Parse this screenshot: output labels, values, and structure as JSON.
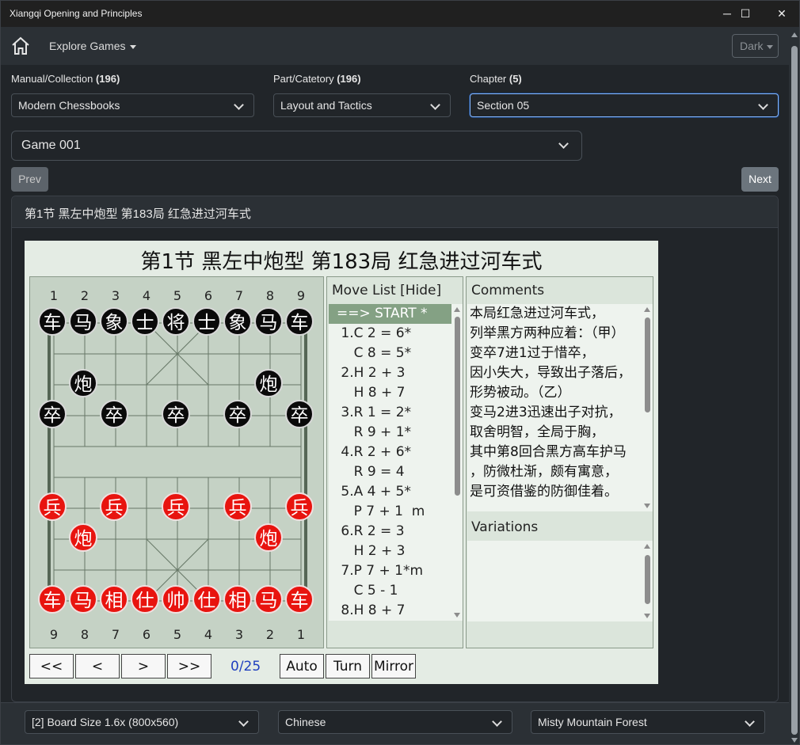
{
  "window": {
    "title": "Xiangqi Opening and Principles",
    "minimize": "─",
    "maximize": "☐",
    "close": "✕"
  },
  "nav": {
    "home_icon": "home-icon",
    "explore": "Explore Games",
    "theme": "Dark"
  },
  "filters": {
    "manual": {
      "label": "Manual/Collection",
      "count": "(196)",
      "value": "Modern Chessbooks"
    },
    "part": {
      "label": "Part/Catetory",
      "count": "(196)",
      "value": "Layout and Tactics"
    },
    "chapter": {
      "label": "Chapter",
      "count": "(5)",
      "value": "Section 05"
    },
    "game": {
      "value": "Game 001"
    }
  },
  "buttons": {
    "prev": "Prev",
    "next": "Next"
  },
  "card": {
    "header": "第1节 黑左中炮型 第183局 红急进过河车式"
  },
  "board": {
    "title": "第1节 黑左中炮型 第183局 红急进过河车式",
    "top_files": [
      "1",
      "2",
      "3",
      "4",
      "5",
      "6",
      "7",
      "8",
      "9"
    ],
    "bottom_files": [
      "9",
      "8",
      "7",
      "6",
      "5",
      "4",
      "3",
      "2",
      "1"
    ],
    "pieces": [
      {
        "side": "black",
        "ch": "车",
        "col": 0,
        "row": 0
      },
      {
        "side": "black",
        "ch": "马",
        "col": 1,
        "row": 0
      },
      {
        "side": "black",
        "ch": "象",
        "col": 2,
        "row": 0
      },
      {
        "side": "black",
        "ch": "士",
        "col": 3,
        "row": 0
      },
      {
        "side": "black",
        "ch": "将",
        "col": 4,
        "row": 0
      },
      {
        "side": "black",
        "ch": "士",
        "col": 5,
        "row": 0
      },
      {
        "side": "black",
        "ch": "象",
        "col": 6,
        "row": 0
      },
      {
        "side": "black",
        "ch": "马",
        "col": 7,
        "row": 0
      },
      {
        "side": "black",
        "ch": "车",
        "col": 8,
        "row": 0
      },
      {
        "side": "black",
        "ch": "炮",
        "col": 1,
        "row": 2
      },
      {
        "side": "black",
        "ch": "炮",
        "col": 7,
        "row": 2
      },
      {
        "side": "black",
        "ch": "卒",
        "col": 0,
        "row": 3
      },
      {
        "side": "black",
        "ch": "卒",
        "col": 2,
        "row": 3
      },
      {
        "side": "black",
        "ch": "卒",
        "col": 4,
        "row": 3
      },
      {
        "side": "black",
        "ch": "卒",
        "col": 6,
        "row": 3
      },
      {
        "side": "black",
        "ch": "卒",
        "col": 8,
        "row": 3
      },
      {
        "side": "red",
        "ch": "兵",
        "col": 0,
        "row": 6
      },
      {
        "side": "red",
        "ch": "兵",
        "col": 2,
        "row": 6
      },
      {
        "side": "red",
        "ch": "兵",
        "col": 4,
        "row": 6
      },
      {
        "side": "red",
        "ch": "兵",
        "col": 6,
        "row": 6
      },
      {
        "side": "red",
        "ch": "兵",
        "col": 8,
        "row": 6
      },
      {
        "side": "red",
        "ch": "炮",
        "col": 1,
        "row": 7
      },
      {
        "side": "red",
        "ch": "炮",
        "col": 7,
        "row": 7
      },
      {
        "side": "red",
        "ch": "车",
        "col": 0,
        "row": 9
      },
      {
        "side": "red",
        "ch": "马",
        "col": 1,
        "row": 9
      },
      {
        "side": "red",
        "ch": "相",
        "col": 2,
        "row": 9
      },
      {
        "side": "red",
        "ch": "仕",
        "col": 3,
        "row": 9
      },
      {
        "side": "red",
        "ch": "帅",
        "col": 4,
        "row": 9
      },
      {
        "side": "red",
        "ch": "仕",
        "col": 5,
        "row": 9
      },
      {
        "side": "red",
        "ch": "相",
        "col": 6,
        "row": 9
      },
      {
        "side": "red",
        "ch": "马",
        "col": 7,
        "row": 9
      },
      {
        "side": "red",
        "ch": "车",
        "col": 8,
        "row": 9
      }
    ]
  },
  "moves": {
    "header": "Move List [Hide]",
    "items": [
      "==> START *",
      " 1.C 2 = 6*",
      "    C 8 = 5*",
      " 2.H 2 + 3",
      "    H 8 + 7",
      " 3.R 1 = 2*",
      "    R 9 + 1*",
      " 4.R 2 + 6*",
      "    R 9 = 4",
      " 5.A 4 + 5*",
      "    P 7 + 1  m",
      " 6.R 2 = 3",
      "    H 2 + 3",
      " 7.P 7 + 1*m",
      "    C 5 - 1",
      " 8.H 8 + 7"
    ]
  },
  "comments": {
    "header": "Comments",
    "lines": [
      "本局红急进过河车式，",
      "列举黑方两种应着：（甲）",
      "变卒7进1过于惜卒，",
      "因小失大，导致出子落后，",
      "形势被动。（乙）",
      "变马2进3迅速出子对抗，",
      "取舍明智，全局于胸，",
      "其中第8回合黑方高车护马",
      "，防微杜渐，颇有寓意，",
      "是可资借鉴的防御佳着。"
    ],
    "variations_header": "Variations"
  },
  "controls": {
    "first": "<<",
    "prev": "<",
    "next": ">",
    "last": ">>",
    "counter": "0/25",
    "auto": "Auto",
    "turn": "Turn",
    "mirror": "Mirror"
  },
  "footer": {
    "board_size": "[2] Board Size 1.6x (800x560)",
    "language": "Chinese",
    "theme": "Misty Mountain Forest"
  },
  "colors": {
    "red_piece": "#e8140f",
    "black_piece": "#0a0a0a",
    "board_bg": "#c5d2c5",
    "current_move": "#84a184",
    "counter_text": "#1e3fbf"
  }
}
